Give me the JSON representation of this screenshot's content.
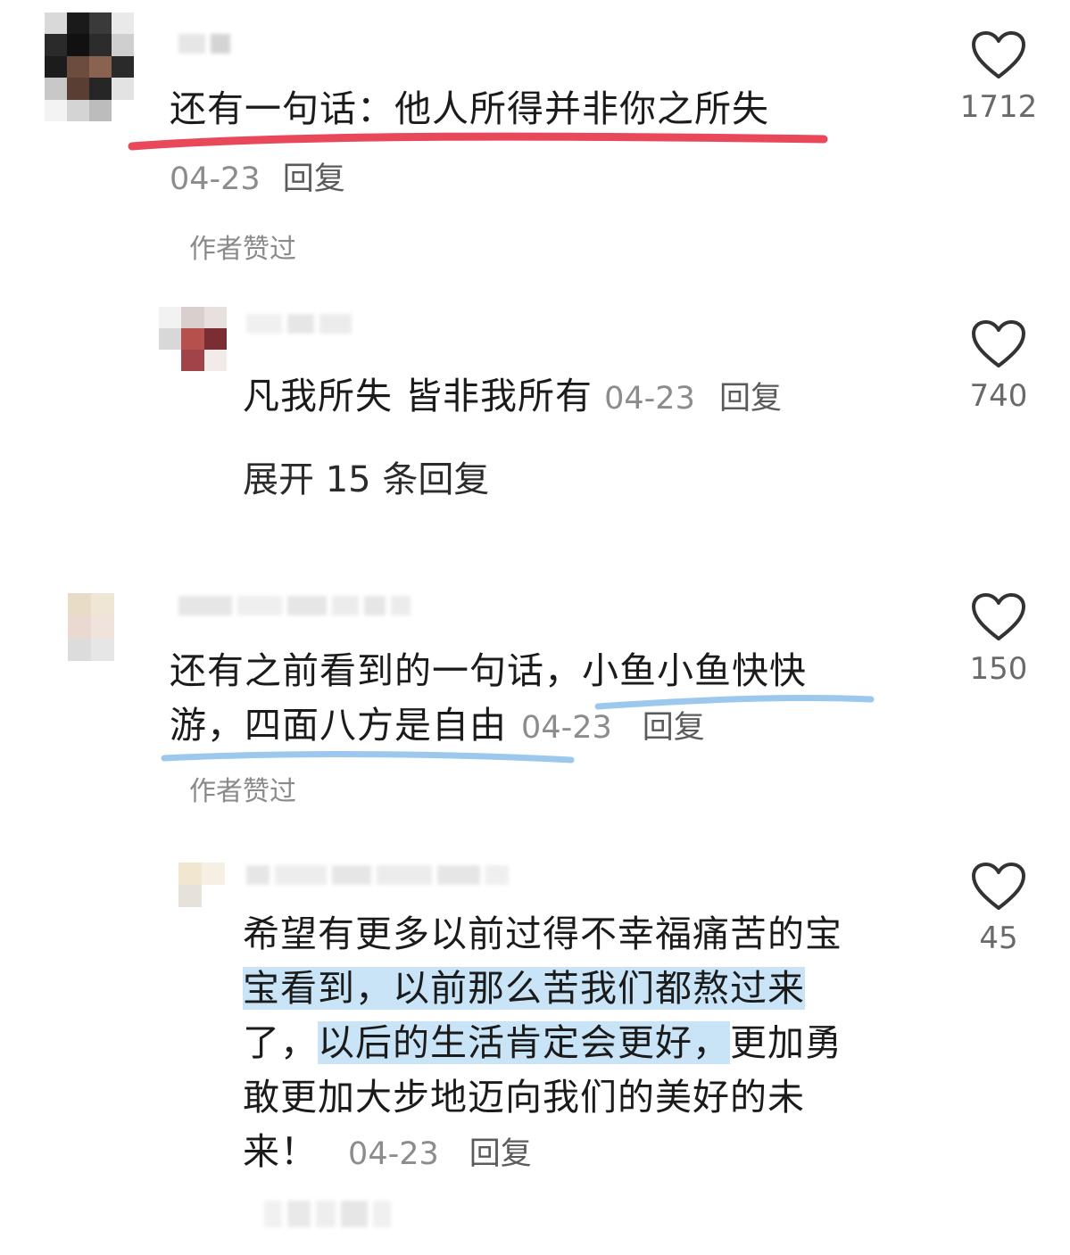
{
  "colors": {
    "red_underline": "#e8485a",
    "blue_underline": "#9cc8ee",
    "highlight": "#c9e4f7"
  },
  "comments": [
    {
      "text": "还有一句话：他人所得并非你之所失",
      "date": "04-23",
      "reply_label": "回复",
      "author_liked": "作者赞过",
      "likes": "1712",
      "replies": [
        {
          "text": "凡我所失 皆非我所有",
          "date": "04-23",
          "reply_label": "回复",
          "likes": "740"
        }
      ],
      "expand_label": "展开 15 条回复"
    },
    {
      "text_line1_a": "还有之前看到的一句话，",
      "text_line1_b": "小鱼小鱼快快",
      "text_line2": "游，四面八方是自由",
      "date": "04-23",
      "reply_label": "回复",
      "author_liked": "作者赞过",
      "likes": "150",
      "replies": [
        {
          "line1": "希望有更多以前过得不幸福痛苦的宝",
          "line2": "宝看到，以前那么苦我们都熬过来",
          "line3_a": "了，",
          "line3_b": "以后的生活肯定会更好，",
          "line3_c": "更加勇",
          "line4": "敢更加大步地迈向我们的美好的未",
          "line5": "来！",
          "date": "04-23",
          "reply_label": "回复",
          "likes": "45"
        }
      ]
    }
  ]
}
